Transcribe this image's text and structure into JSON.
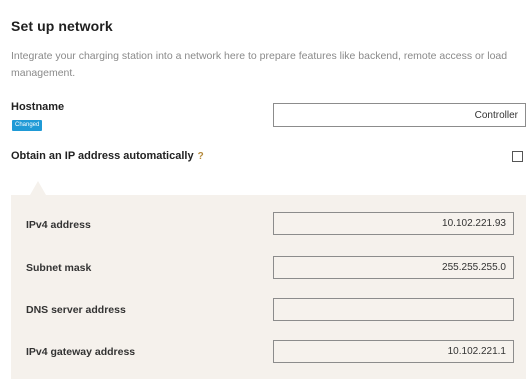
{
  "page": {
    "title": "Set up network",
    "description": "Integrate your charging station into a network here to prepare features like backend, remote access or load management."
  },
  "hostname": {
    "label": "Hostname",
    "badge": "Changed",
    "value": "Controller"
  },
  "auto_ip": {
    "label": "Obtain an IP address automatically",
    "help_icon": "?",
    "checked": false
  },
  "ip_settings": {
    "ipv4_address": {
      "label": "IPv4 address",
      "value": "10.102.221.93"
    },
    "subnet_mask": {
      "label": "Subnet mask",
      "value": "255.255.255.0"
    },
    "dns_server": {
      "label": "DNS server address",
      "value": ""
    },
    "ipv4_gateway": {
      "label": "IPv4 gateway address",
      "value": "10.102.221.1"
    }
  },
  "colors": {
    "badge": "#1f9ad6",
    "panel_background": "#f5f1ec",
    "help_icon": "#b58a3c"
  }
}
